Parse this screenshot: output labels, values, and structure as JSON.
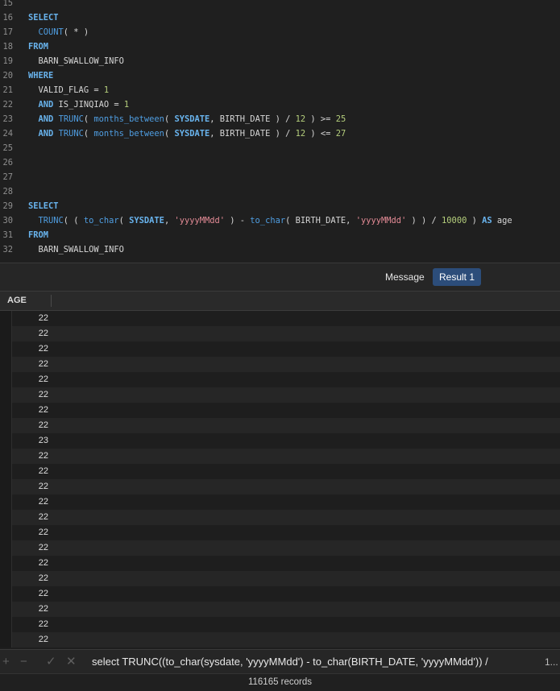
{
  "editor": {
    "lines": [
      {
        "n": "15",
        "tokens": []
      },
      {
        "n": "16",
        "tokens": [
          [
            "kw",
            "SELECT"
          ]
        ]
      },
      {
        "n": "17",
        "tokens": [
          [
            "plain",
            "  "
          ],
          [
            "fn",
            "COUNT"
          ],
          [
            "plain",
            "( * )"
          ]
        ]
      },
      {
        "n": "18",
        "tokens": [
          [
            "kw",
            "FROM"
          ]
        ]
      },
      {
        "n": "19",
        "tokens": [
          [
            "plain",
            "  BARN_SWALLOW_INFO"
          ]
        ]
      },
      {
        "n": "20",
        "tokens": [
          [
            "kw",
            "WHERE"
          ]
        ]
      },
      {
        "n": "21",
        "tokens": [
          [
            "plain",
            "  VALID_FLAG = "
          ],
          [
            "num",
            "1"
          ]
        ]
      },
      {
        "n": "22",
        "tokens": [
          [
            "plain",
            "  "
          ],
          [
            "kw",
            "AND"
          ],
          [
            "plain",
            " IS_JINQIAO = "
          ],
          [
            "num",
            "1"
          ]
        ]
      },
      {
        "n": "23",
        "tokens": [
          [
            "plain",
            "  "
          ],
          [
            "kw",
            "AND"
          ],
          [
            "plain",
            " "
          ],
          [
            "fn",
            "TRUNC"
          ],
          [
            "plain",
            "( "
          ],
          [
            "fn",
            "months_between"
          ],
          [
            "plain",
            "( "
          ],
          [
            "kw",
            "SYSDATE"
          ],
          [
            "plain",
            ", BIRTH_DATE ) / "
          ],
          [
            "num",
            "12"
          ],
          [
            "plain",
            " ) >= "
          ],
          [
            "num",
            "25"
          ]
        ]
      },
      {
        "n": "24",
        "tokens": [
          [
            "plain",
            "  "
          ],
          [
            "kw",
            "AND"
          ],
          [
            "plain",
            " "
          ],
          [
            "fn",
            "TRUNC"
          ],
          [
            "plain",
            "( "
          ],
          [
            "fn",
            "months_between"
          ],
          [
            "plain",
            "( "
          ],
          [
            "kw",
            "SYSDATE"
          ],
          [
            "plain",
            ", BIRTH_DATE ) / "
          ],
          [
            "num",
            "12"
          ],
          [
            "plain",
            " ) <= "
          ],
          [
            "num",
            "27"
          ]
        ]
      },
      {
        "n": "25",
        "tokens": []
      },
      {
        "n": "26",
        "tokens": []
      },
      {
        "n": "27",
        "tokens": []
      },
      {
        "n": "28",
        "tokens": []
      },
      {
        "n": "29",
        "tokens": [
          [
            "kw",
            "SELECT"
          ]
        ]
      },
      {
        "n": "30",
        "tokens": [
          [
            "plain",
            "  "
          ],
          [
            "fn",
            "TRUNC"
          ],
          [
            "plain",
            "( ( "
          ],
          [
            "fn",
            "to_char"
          ],
          [
            "plain",
            "( "
          ],
          [
            "kw",
            "SYSDATE"
          ],
          [
            "plain",
            ", "
          ],
          [
            "str",
            "'yyyyMMdd'"
          ],
          [
            "plain",
            " ) - "
          ],
          [
            "fn",
            "to_char"
          ],
          [
            "plain",
            "( BIRTH_DATE, "
          ],
          [
            "str",
            "'yyyyMMdd'"
          ],
          [
            "plain",
            " ) ) / "
          ],
          [
            "num",
            "10000"
          ],
          [
            "plain",
            " ) "
          ],
          [
            "kw",
            "AS"
          ],
          [
            "plain",
            " age"
          ]
        ]
      },
      {
        "n": "31",
        "tokens": [
          [
            "kw",
            "FROM"
          ]
        ]
      },
      {
        "n": "32",
        "tokens": [
          [
            "plain",
            "  BARN_SWALLOW_INFO"
          ]
        ]
      }
    ]
  },
  "tabs": {
    "message": "Message",
    "result": "Result 1"
  },
  "grid": {
    "column": "AGE",
    "rows": [
      "22",
      "22",
      "22",
      "22",
      "22",
      "22",
      "22",
      "22",
      "23",
      "22",
      "22",
      "22",
      "22",
      "22",
      "22",
      "22",
      "22",
      "22",
      "22",
      "22",
      "22",
      "22"
    ]
  },
  "bottom": {
    "query": "select TRUNC((to_char(sysdate, 'yyyyMMdd') - to_char(BIRTH_DATE, 'yyyyMMdd')) /",
    "page_indicator": "1...",
    "records": "116165 records",
    "icons": {
      "add": "+",
      "remove": "−",
      "apply": "✓",
      "discard": "✕"
    }
  },
  "colors": {
    "keyword": "#69b4ee",
    "function": "#4f9ee2",
    "number": "#b5cf7c",
    "string": "#e48b96",
    "active_tab": "#2c4d7a"
  }
}
